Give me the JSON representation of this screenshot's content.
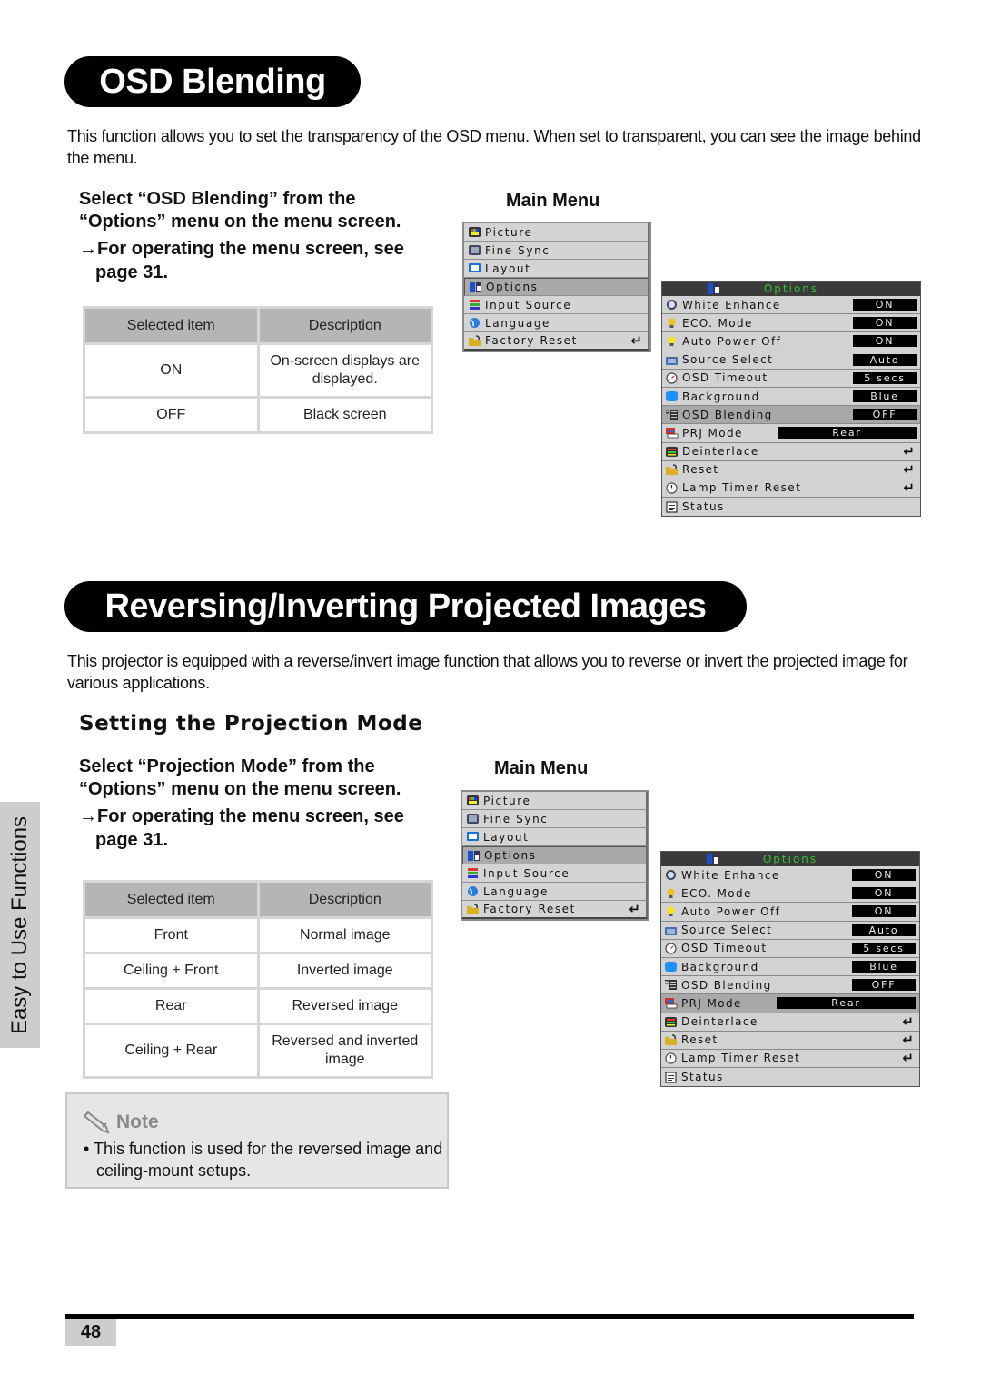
{
  "section1": {
    "title": "OSD Blending",
    "intro": "This function allows you to set the transparency of the OSD menu. When set to transparent, you can see the image behind the menu.",
    "instruction": "Select “OSD Blending” from the “Options” menu on the menu screen.",
    "reference": "→For operating the menu screen, see page 31.",
    "table": {
      "headers": [
        "Selected item",
        "Description"
      ],
      "rows": [
        {
          "item": "ON",
          "description": "On-screen displays are displayed."
        },
        {
          "item": "OFF",
          "description": "Black screen"
        }
      ]
    },
    "menu_label": "Main Menu",
    "main_menu": {
      "items": [
        {
          "label": "Picture",
          "icon": "picture-icon"
        },
        {
          "label": "Fine Sync",
          "icon": "fine-sync-icon"
        },
        {
          "label": "Layout",
          "icon": "layout-icon"
        },
        {
          "label": "Options",
          "icon": "options-icon",
          "selected": true
        },
        {
          "label": "Input Source",
          "icon": "input-source-icon"
        },
        {
          "label": "Language",
          "icon": "globe-icon"
        },
        {
          "label": "Factory Reset",
          "icon": "folder-icon",
          "enter": "↵"
        }
      ]
    },
    "options_menu": {
      "header": "Options",
      "items": [
        {
          "label": "White Enhance",
          "value": "ON"
        },
        {
          "label": "ECO. Mode",
          "value": "ON"
        },
        {
          "label": "Auto Power Off",
          "value": "ON"
        },
        {
          "label": "Source Select",
          "value": "Auto"
        },
        {
          "label": "OSD Timeout",
          "value": "5 secs"
        },
        {
          "label": "Background",
          "value": "Blue"
        },
        {
          "label": "OSD Blending",
          "value": "OFF",
          "selected": true
        },
        {
          "label": "PRJ Mode",
          "value": "Rear"
        },
        {
          "label": "Deinterlace",
          "enter": "↵"
        },
        {
          "label": "Reset",
          "enter": "↵"
        },
        {
          "label": "Lamp Timer Reset",
          "enter": "↵"
        },
        {
          "label": "Status"
        }
      ]
    }
  },
  "section2": {
    "title": "Reversing/Inverting Projected Images",
    "intro": "This projector is equipped with a reverse/invert image function that allows you to reverse or invert the projected image for various applications.",
    "subheading": "Setting the Projection Mode",
    "instruction": "Select “Projection Mode” from the “Options” menu on the menu screen.",
    "reference": "→For operating the menu screen, see page 31.",
    "table": {
      "headers": [
        "Selected item",
        "Description"
      ],
      "rows": [
        {
          "item": "Front",
          "description": "Normal image"
        },
        {
          "item": "Ceiling + Front",
          "description": "Inverted image"
        },
        {
          "item": "Rear",
          "description": "Reversed image"
        },
        {
          "item": "Ceiling + Rear",
          "description": "Reversed and inverted image"
        }
      ]
    },
    "menu_label": "Main Menu",
    "main_menu": {
      "items": [
        {
          "label": "Picture"
        },
        {
          "label": "Fine Sync"
        },
        {
          "label": "Layout"
        },
        {
          "label": "Options",
          "selected": true
        },
        {
          "label": "Input Source"
        },
        {
          "label": "Language"
        },
        {
          "label": "Factory Reset",
          "enter": "↵"
        }
      ]
    },
    "options_menu": {
      "header": "Options",
      "items": [
        {
          "label": "White Enhance",
          "value": "ON"
        },
        {
          "label": "ECO. Mode",
          "value": "ON"
        },
        {
          "label": "Auto Power Off",
          "value": "ON"
        },
        {
          "label": "Source Select",
          "value": "Auto"
        },
        {
          "label": "OSD Timeout",
          "value": "5 secs"
        },
        {
          "label": "Background",
          "value": "Blue"
        },
        {
          "label": "OSD Blending",
          "value": "OFF"
        },
        {
          "label": "PRJ Mode",
          "value": "Rear",
          "selected": true
        },
        {
          "label": "Deinterlace",
          "enter": "↵"
        },
        {
          "label": "Reset",
          "enter": "↵"
        },
        {
          "label": "Lamp Timer Reset",
          "enter": "↵"
        },
        {
          "label": "Status"
        }
      ]
    },
    "note": {
      "title": "Note",
      "bullet": "•",
      "text": "This function is used for the reversed image and ceiling-mount setups."
    }
  },
  "side_tab": "Easy to Use Functions",
  "page_number": "48",
  "colors": {
    "osd_header_text": "#33c233",
    "table_header_bg": "#b5b5b5",
    "side_tab_bg": "#cdcdcd",
    "note_bg": "#e6e6e6"
  }
}
